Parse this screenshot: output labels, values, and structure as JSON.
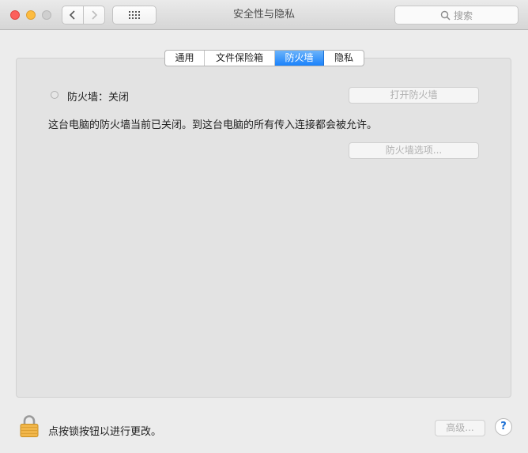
{
  "window": {
    "title": "安全性与隐私"
  },
  "toolbar": {
    "back_icon": "chevron-left-icon",
    "forward_icon": "chevron-right-icon",
    "grid_icon": "grid-icon"
  },
  "search": {
    "placeholder": "搜索",
    "icon": "search-icon"
  },
  "tabs": [
    {
      "label": "通用",
      "selected": false
    },
    {
      "label": "文件保险箱",
      "selected": false
    },
    {
      "label": "防火墙",
      "selected": true
    },
    {
      "label": "隐私",
      "selected": false
    }
  ],
  "firewall": {
    "status_label": "防火墙：关闭",
    "turn_on_button": "打开防火墙",
    "description": "这台电脑的防火墙当前已关闭。到这台电脑的所有传入连接都会被允许。",
    "options_button": "防火墙选项..."
  },
  "footer": {
    "lock_icon": "lock-icon",
    "lock_label": "点按锁按钮以进行更改。",
    "advanced_button": "高级...",
    "help_label": "?"
  },
  "colors": {
    "accent": "#1a82fb",
    "close": "#fc605c",
    "minimize": "#fdbc40",
    "zoom_disabled": "#cfcfcf"
  }
}
